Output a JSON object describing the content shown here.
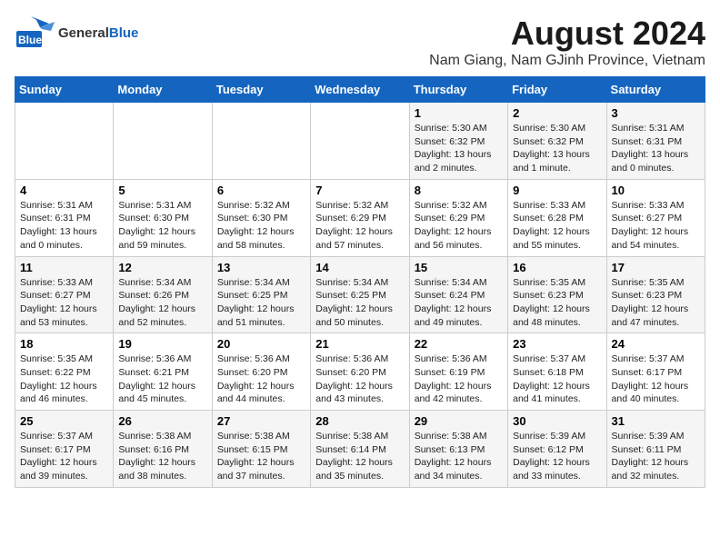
{
  "header": {
    "logo_general": "General",
    "logo_blue": "Blue",
    "title": "August 2024",
    "subtitle": "Nam Giang, Nam GJinh Province, Vietnam"
  },
  "weekdays": [
    "Sunday",
    "Monday",
    "Tuesday",
    "Wednesday",
    "Thursday",
    "Friday",
    "Saturday"
  ],
  "weeks": [
    [
      {
        "day": "",
        "info": ""
      },
      {
        "day": "",
        "info": ""
      },
      {
        "day": "",
        "info": ""
      },
      {
        "day": "",
        "info": ""
      },
      {
        "day": "1",
        "info": "Sunrise: 5:30 AM\nSunset: 6:32 PM\nDaylight: 13 hours\nand 2 minutes."
      },
      {
        "day": "2",
        "info": "Sunrise: 5:30 AM\nSunset: 6:32 PM\nDaylight: 13 hours\nand 1 minute."
      },
      {
        "day": "3",
        "info": "Sunrise: 5:31 AM\nSunset: 6:31 PM\nDaylight: 13 hours\nand 0 minutes."
      }
    ],
    [
      {
        "day": "4",
        "info": "Sunrise: 5:31 AM\nSunset: 6:31 PM\nDaylight: 13 hours\nand 0 minutes."
      },
      {
        "day": "5",
        "info": "Sunrise: 5:31 AM\nSunset: 6:30 PM\nDaylight: 12 hours\nand 59 minutes."
      },
      {
        "day": "6",
        "info": "Sunrise: 5:32 AM\nSunset: 6:30 PM\nDaylight: 12 hours\nand 58 minutes."
      },
      {
        "day": "7",
        "info": "Sunrise: 5:32 AM\nSunset: 6:29 PM\nDaylight: 12 hours\nand 57 minutes."
      },
      {
        "day": "8",
        "info": "Sunrise: 5:32 AM\nSunset: 6:29 PM\nDaylight: 12 hours\nand 56 minutes."
      },
      {
        "day": "9",
        "info": "Sunrise: 5:33 AM\nSunset: 6:28 PM\nDaylight: 12 hours\nand 55 minutes."
      },
      {
        "day": "10",
        "info": "Sunrise: 5:33 AM\nSunset: 6:27 PM\nDaylight: 12 hours\nand 54 minutes."
      }
    ],
    [
      {
        "day": "11",
        "info": "Sunrise: 5:33 AM\nSunset: 6:27 PM\nDaylight: 12 hours\nand 53 minutes."
      },
      {
        "day": "12",
        "info": "Sunrise: 5:34 AM\nSunset: 6:26 PM\nDaylight: 12 hours\nand 52 minutes."
      },
      {
        "day": "13",
        "info": "Sunrise: 5:34 AM\nSunset: 6:25 PM\nDaylight: 12 hours\nand 51 minutes."
      },
      {
        "day": "14",
        "info": "Sunrise: 5:34 AM\nSunset: 6:25 PM\nDaylight: 12 hours\nand 50 minutes."
      },
      {
        "day": "15",
        "info": "Sunrise: 5:34 AM\nSunset: 6:24 PM\nDaylight: 12 hours\nand 49 minutes."
      },
      {
        "day": "16",
        "info": "Sunrise: 5:35 AM\nSunset: 6:23 PM\nDaylight: 12 hours\nand 48 minutes."
      },
      {
        "day": "17",
        "info": "Sunrise: 5:35 AM\nSunset: 6:23 PM\nDaylight: 12 hours\nand 47 minutes."
      }
    ],
    [
      {
        "day": "18",
        "info": "Sunrise: 5:35 AM\nSunset: 6:22 PM\nDaylight: 12 hours\nand 46 minutes."
      },
      {
        "day": "19",
        "info": "Sunrise: 5:36 AM\nSunset: 6:21 PM\nDaylight: 12 hours\nand 45 minutes."
      },
      {
        "day": "20",
        "info": "Sunrise: 5:36 AM\nSunset: 6:20 PM\nDaylight: 12 hours\nand 44 minutes."
      },
      {
        "day": "21",
        "info": "Sunrise: 5:36 AM\nSunset: 6:20 PM\nDaylight: 12 hours\nand 43 minutes."
      },
      {
        "day": "22",
        "info": "Sunrise: 5:36 AM\nSunset: 6:19 PM\nDaylight: 12 hours\nand 42 minutes."
      },
      {
        "day": "23",
        "info": "Sunrise: 5:37 AM\nSunset: 6:18 PM\nDaylight: 12 hours\nand 41 minutes."
      },
      {
        "day": "24",
        "info": "Sunrise: 5:37 AM\nSunset: 6:17 PM\nDaylight: 12 hours\nand 40 minutes."
      }
    ],
    [
      {
        "day": "25",
        "info": "Sunrise: 5:37 AM\nSunset: 6:17 PM\nDaylight: 12 hours\nand 39 minutes."
      },
      {
        "day": "26",
        "info": "Sunrise: 5:38 AM\nSunset: 6:16 PM\nDaylight: 12 hours\nand 38 minutes."
      },
      {
        "day": "27",
        "info": "Sunrise: 5:38 AM\nSunset: 6:15 PM\nDaylight: 12 hours\nand 37 minutes."
      },
      {
        "day": "28",
        "info": "Sunrise: 5:38 AM\nSunset: 6:14 PM\nDaylight: 12 hours\nand 35 minutes."
      },
      {
        "day": "29",
        "info": "Sunrise: 5:38 AM\nSunset: 6:13 PM\nDaylight: 12 hours\nand 34 minutes."
      },
      {
        "day": "30",
        "info": "Sunrise: 5:39 AM\nSunset: 6:12 PM\nDaylight: 12 hours\nand 33 minutes."
      },
      {
        "day": "31",
        "info": "Sunrise: 5:39 AM\nSunset: 6:11 PM\nDaylight: 12 hours\nand 32 minutes."
      }
    ]
  ]
}
